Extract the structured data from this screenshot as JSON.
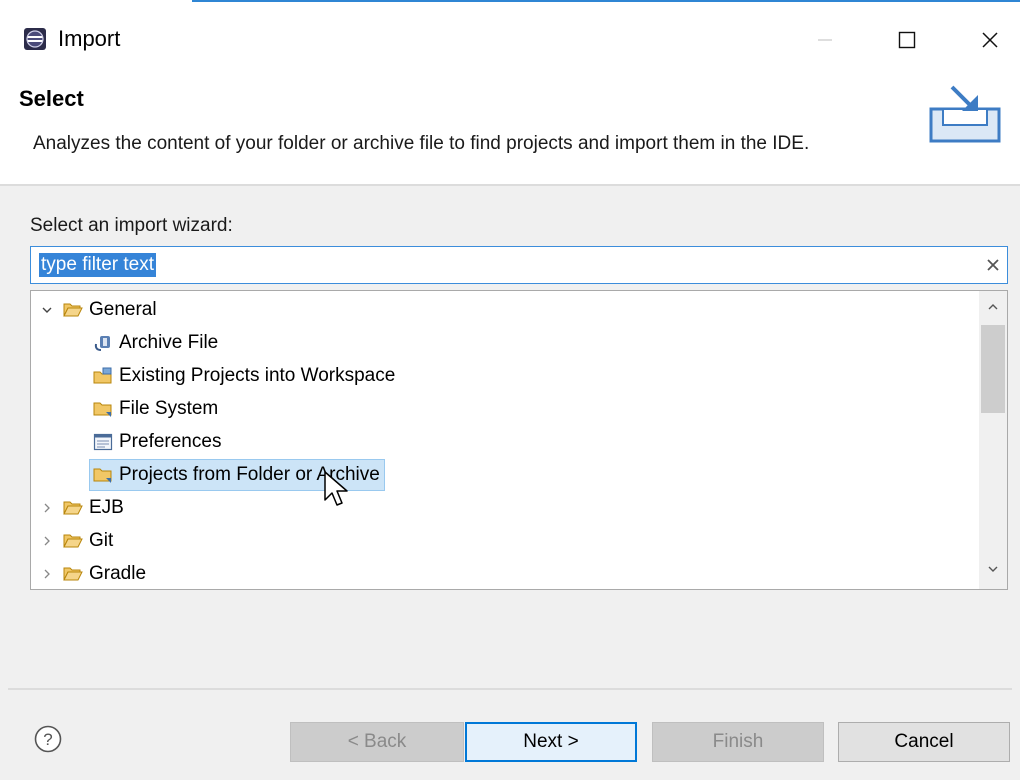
{
  "window": {
    "title": "Import",
    "icon": "eclipse-icon",
    "controls": {
      "minimize": "minimize-icon",
      "maximize": "maximize-icon",
      "close": "close-icon"
    }
  },
  "header": {
    "title": "Select",
    "description": "Analyzes the content of your folder or archive file to find projects and import them in the IDE.",
    "icon": "import-banner-icon"
  },
  "wizard": {
    "label": "Select an import wizard:",
    "filter_text": "type filter text",
    "clear_icon": "clear-icon"
  },
  "tree": [
    {
      "label": "General",
      "level": 0,
      "expanded": true,
      "icon": "folder-open-icon",
      "selected": false
    },
    {
      "label": "Archive File",
      "level": 1,
      "icon": "archive-file-icon",
      "selected": false
    },
    {
      "label": "Existing Projects into Workspace",
      "level": 1,
      "icon": "existing-projects-icon",
      "selected": false
    },
    {
      "label": "File System",
      "level": 1,
      "icon": "file-system-folder-icon",
      "selected": false
    },
    {
      "label": "Preferences",
      "level": 1,
      "icon": "preferences-icon",
      "selected": false
    },
    {
      "label": "Projects from Folder or Archive",
      "level": 1,
      "icon": "projects-folder-icon",
      "selected": true
    },
    {
      "label": "EJB",
      "level": 0,
      "expanded": false,
      "icon": "folder-open-icon",
      "selected": false
    },
    {
      "label": "Git",
      "level": 0,
      "expanded": false,
      "icon": "folder-open-icon",
      "selected": false
    },
    {
      "label": "Gradle",
      "level": 0,
      "expanded": false,
      "icon": "folder-open-icon",
      "selected": false
    }
  ],
  "buttons": {
    "back": "< Back",
    "next": "Next >",
    "finish": "Finish",
    "cancel": "Cancel",
    "help_icon": "help-icon"
  },
  "colors": {
    "accent": "#0078d7",
    "selection": "#cce4f7",
    "filter_highlight": "#3584d8",
    "folder": "#e8b84a"
  }
}
